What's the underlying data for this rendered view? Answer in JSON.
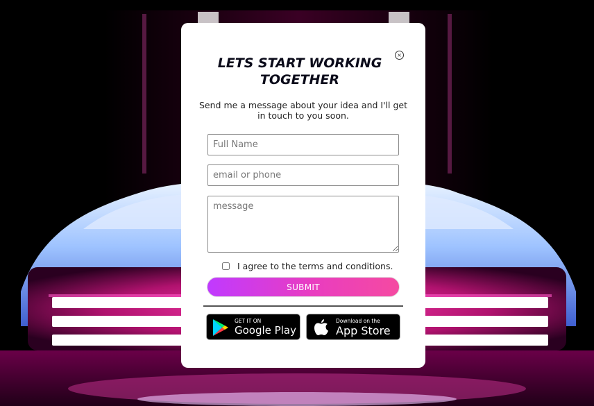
{
  "modal": {
    "close_symbol": "×",
    "title": "LETS START WORKING TOGETHER",
    "subtitle": "Send me a message about your idea and I'll get in touch to you soon.",
    "fields": {
      "name_placeholder": "Full Name",
      "contact_placeholder": "email or phone",
      "message_placeholder": "message"
    },
    "terms_label": "I agree to the terms and conditions.",
    "submit_label": "SUBMIT",
    "stores": {
      "google_play": {
        "small": "GET IT ON",
        "big": "Google Play"
      },
      "app_store": {
        "small": "Download on the",
        "big": "App Store"
      }
    }
  },
  "colors": {
    "submit_gradient_start": "#c03aff",
    "submit_gradient_end": "#f54aa1",
    "background": "#000000",
    "neon_pink": "#ff2fa8"
  },
  "icons": [
    "close-icon",
    "google-play-icon",
    "apple-icon"
  ]
}
